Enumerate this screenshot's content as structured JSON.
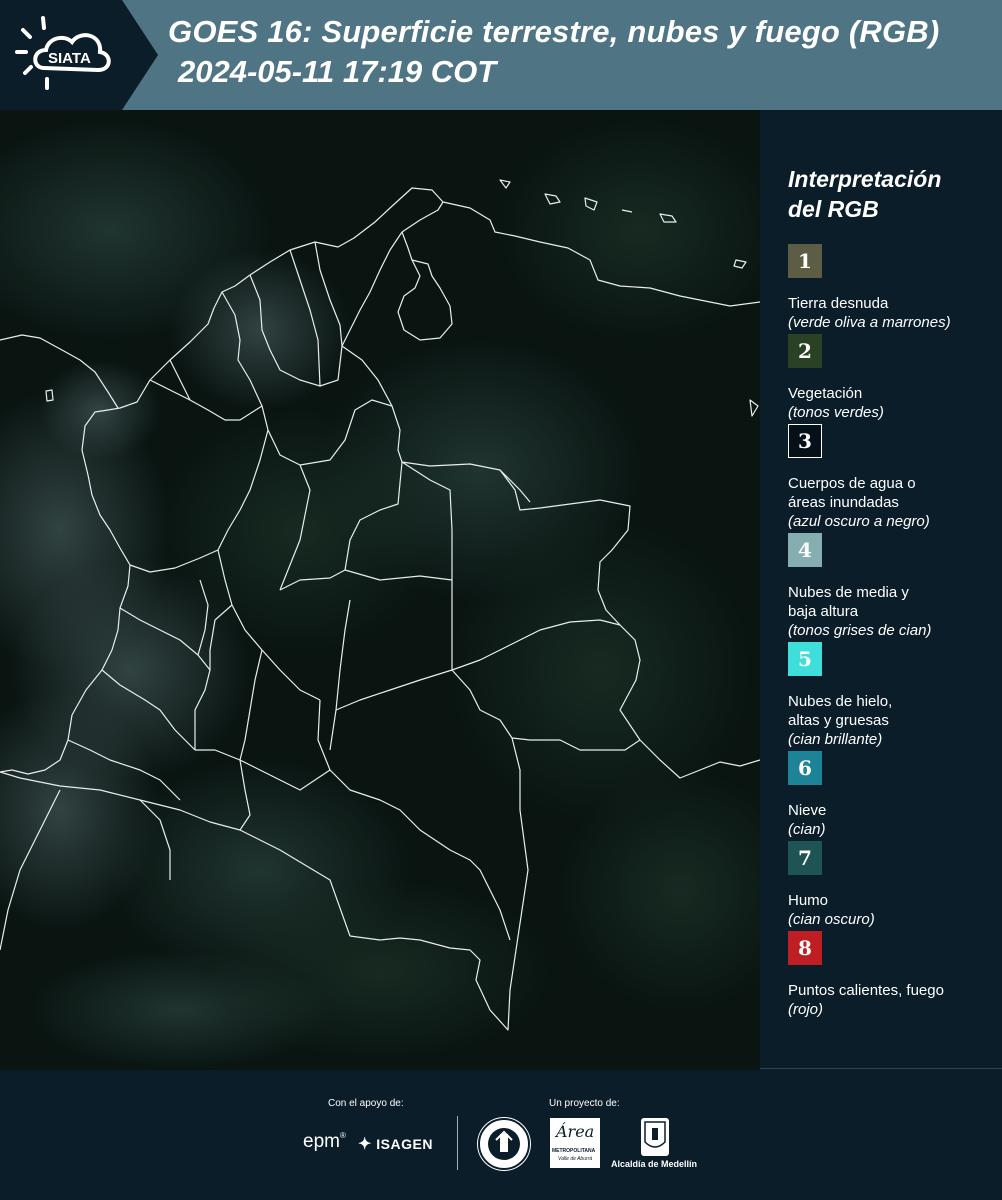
{
  "header": {
    "logo_text": "SIATA",
    "title_line1": "GOES 16: Superficie terrestre, nubes y fuego (RGB)",
    "title_line2": "2024-05-11 17:19 COT"
  },
  "legend": {
    "title_line1": "Interpretación",
    "title_line2": "del RGB",
    "items": [
      {
        "number": "1",
        "color": "#5d5d45",
        "label_lines": [
          "Tierra desnuda"
        ],
        "desc": "(verde oliva a marrones)"
      },
      {
        "number": "2",
        "color": "#2b4125",
        "label_lines": [
          "Vegetación"
        ],
        "desc": "(tonos verdes)"
      },
      {
        "number": "3",
        "color": "#061018",
        "label_lines": [
          "Cuerpos de agua o",
          "áreas inundadas"
        ],
        "desc": "(azul oscuro a negro)"
      },
      {
        "number": "4",
        "color": "#86aeb0",
        "label_lines": [
          "Nubes de media y",
          "baja altura"
        ],
        "desc": "(tonos grises de cian)"
      },
      {
        "number": "5",
        "color": "#3fdedb",
        "label_lines": [
          "Nubes de hielo,",
          "altas y gruesas"
        ],
        "desc": "(cian brillante)"
      },
      {
        "number": "6",
        "color": "#1d8397",
        "label_lines": [
          "Nieve"
        ],
        "desc": "(cian)"
      },
      {
        "number": "7",
        "color": "#1f5454",
        "label_lines": [
          "Humo"
        ],
        "desc": "(cian oscuro)"
      },
      {
        "number": "8",
        "color": "#bf1e22",
        "label_lines": [
          "Puntos calientes, fuego"
        ],
        "desc": "(rojo)"
      }
    ]
  },
  "footer": {
    "support_label": "Con el apoyo de:",
    "project_label": "Un proyecto de:",
    "brand_epm": "epm",
    "brand_isagen": "ISAGEN",
    "brand_area": "Área",
    "brand_area_sub": "METROPOLITANA",
    "brand_area_sub2": "Valle de Aburrá",
    "brand_alcaldia": "Alcaldía de Medellín"
  }
}
